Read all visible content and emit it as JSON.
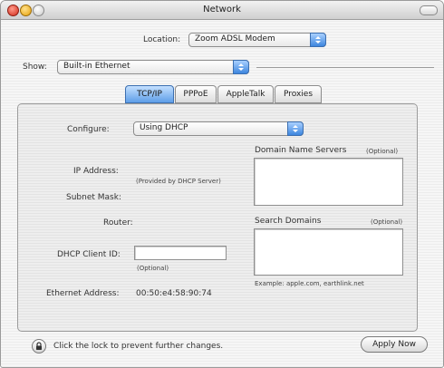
{
  "window": {
    "title": "Network"
  },
  "location": {
    "label": "Location:",
    "value": "Zoom ADSL Modem"
  },
  "show": {
    "label": "Show:",
    "value": "Built-in Ethernet"
  },
  "tabs": [
    {
      "label": "TCP/IP",
      "active": true
    },
    {
      "label": "PPPoE",
      "active": false
    },
    {
      "label": "AppleTalk",
      "active": false
    },
    {
      "label": "Proxies",
      "active": false
    }
  ],
  "tcpip": {
    "configure_label": "Configure:",
    "configure_value": "Using DHCP",
    "dns_label": "Domain Name Servers",
    "dns_optional": "(Optional)",
    "ip_label": "IP Address:",
    "ip_note": "(Provided by DHCP Server)",
    "subnet_label": "Subnet Mask:",
    "router_label": "Router:",
    "search_label": "Search Domains",
    "search_optional": "(Optional)",
    "dhcp_client_label": "DHCP Client ID:",
    "dhcp_client_value": "",
    "dhcp_client_note": "(Optional)",
    "example_text": "Example: apple.com, earthlink.net",
    "ethernet_label": "Ethernet Address:",
    "ethernet_value": "00:50:e4:58:90:74"
  },
  "footer": {
    "lock_text": "Click the lock to prevent further changes.",
    "apply_label": "Apply Now"
  },
  "colors": {
    "accent": "#3d86de",
    "tab_active": "#5e9ee8"
  },
  "icons": [
    "close-icon",
    "minimize-icon",
    "zoom-icon",
    "lock-icon",
    "updown-arrows-icon"
  ]
}
